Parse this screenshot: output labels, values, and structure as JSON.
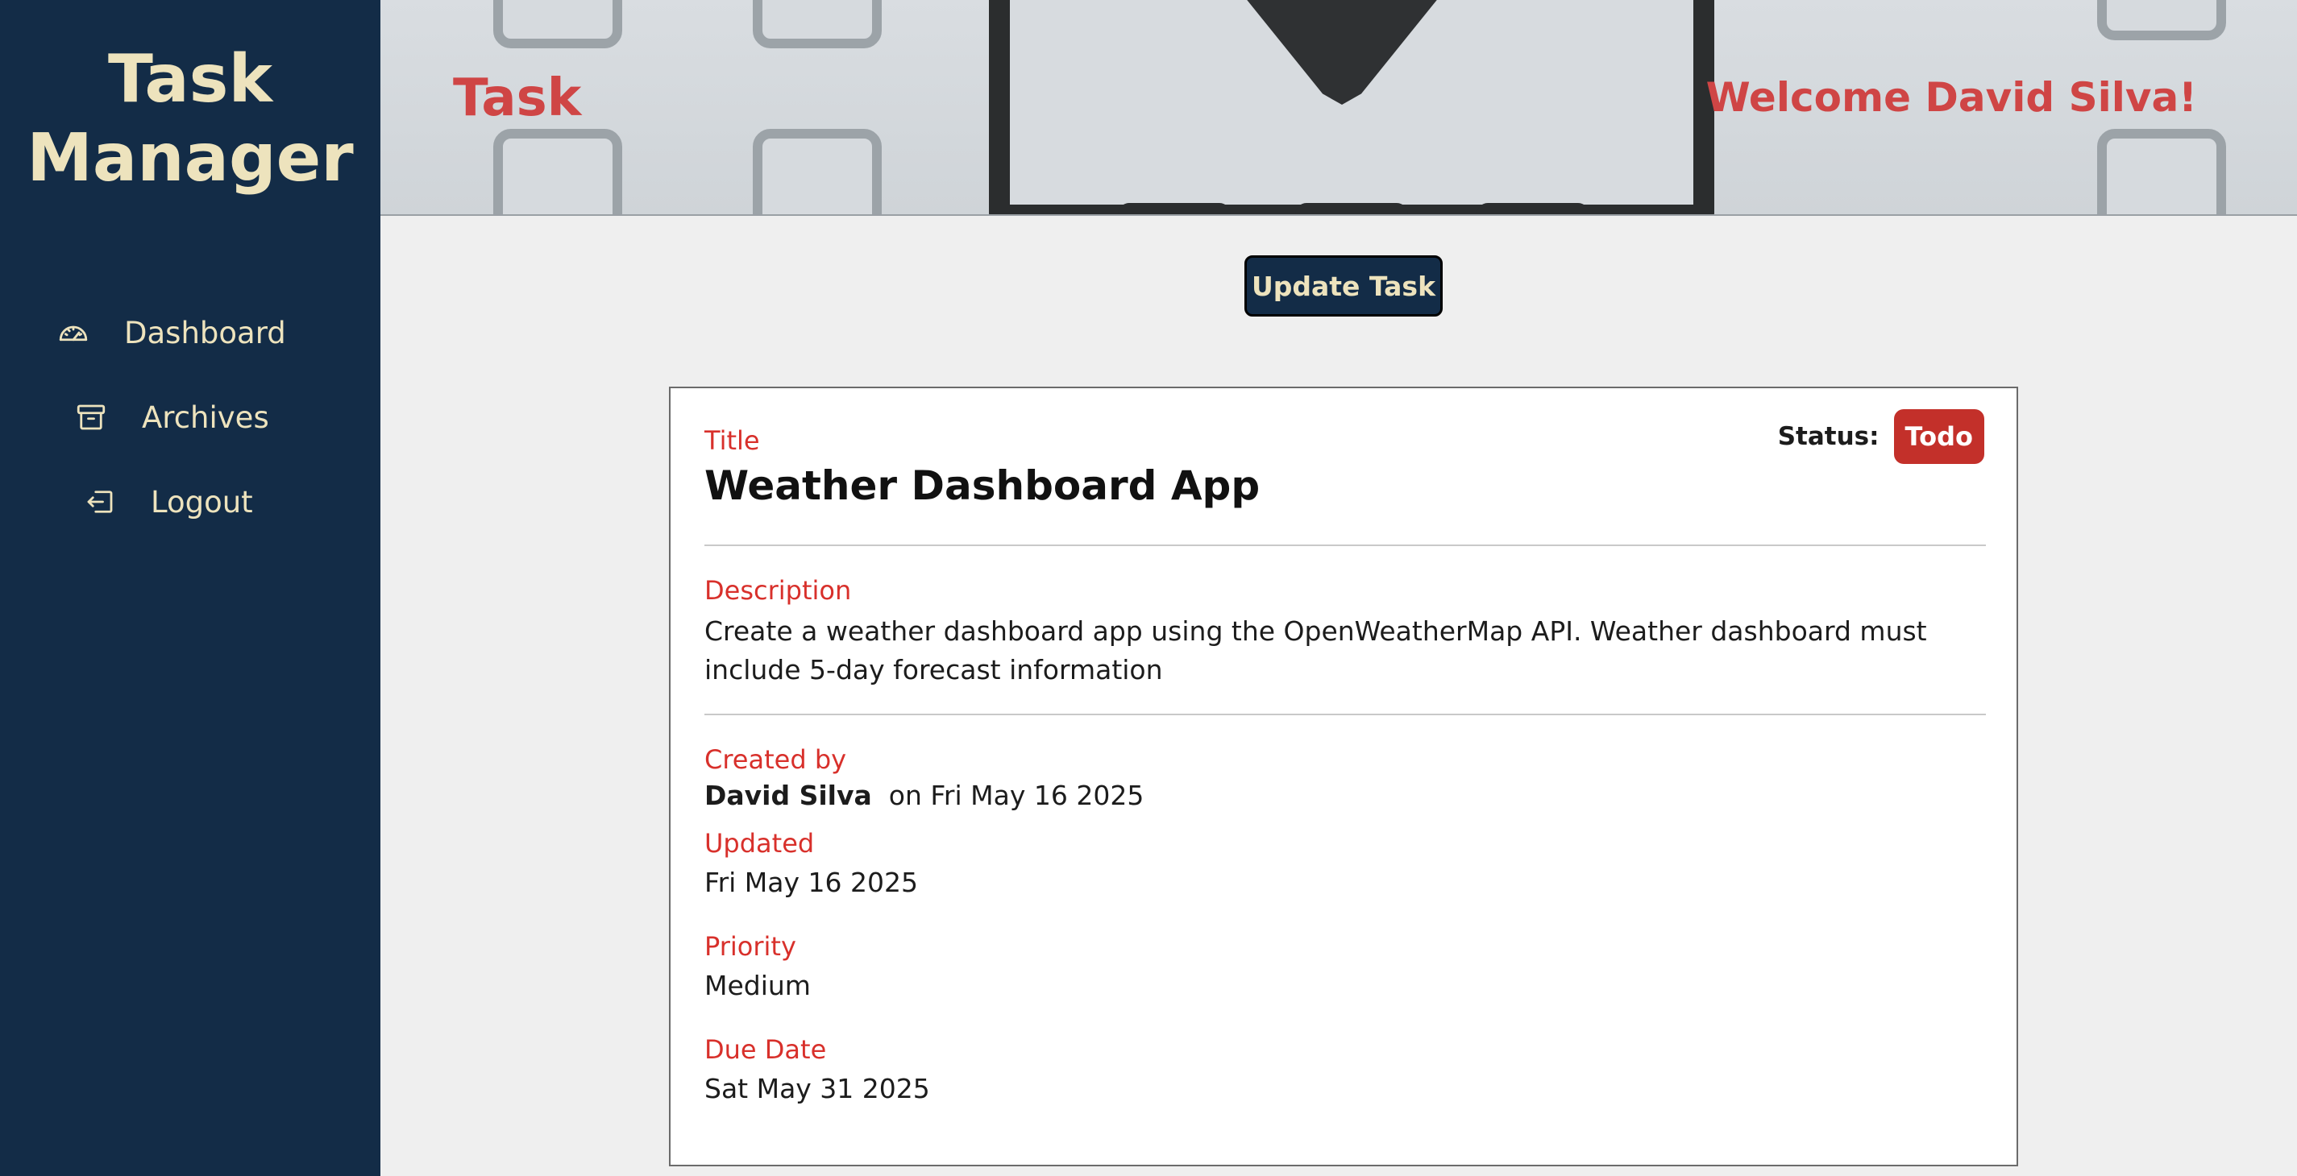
{
  "sidebar": {
    "brand_line1": "Task",
    "brand_line2": "Manager",
    "items": [
      {
        "label": "Dashboard",
        "icon": "speedometer-icon"
      },
      {
        "label": "Archives",
        "icon": "archive-box-icon"
      },
      {
        "label": "Logout",
        "icon": "logout-icon"
      }
    ]
  },
  "header": {
    "page_title": "Task",
    "welcome": "Welcome David Silva!"
  },
  "actions": {
    "update_label": "Update Task"
  },
  "task": {
    "title_label": "Title",
    "title": "Weather Dashboard App",
    "status_label": "Status:",
    "status": "Todo",
    "description_label": "Description",
    "description": "Create a weather dashboard app using the OpenWeatherMap API. Weather dashboard must include 5-day forecast information",
    "created_by_label": "Created by",
    "created_by": "David Silva",
    "created_on": "on Fri May 16 2025",
    "updated_label": "Updated",
    "updated": "Fri May 16 2025",
    "priority_label": "Priority",
    "priority": "Medium",
    "due_label": "Due Date",
    "due": "Sat May 31 2025"
  },
  "colors": {
    "sidebar_bg": "#132c47",
    "sidebar_text": "#ede3bd",
    "accent_red": "#cf4545",
    "label_red": "#d8302b",
    "status_badge": "#c3302a"
  }
}
